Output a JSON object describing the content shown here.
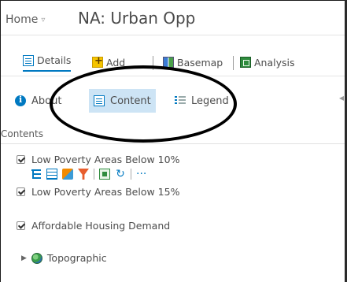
{
  "header": {
    "home_label": "Home",
    "home_chevron": "▿",
    "map_title": "NA: Urban Opp"
  },
  "toolbar": {
    "details_label": "Details",
    "add_label": "Add",
    "basemap_label": "Basemap",
    "analysis_label": "Analysis"
  },
  "tabs": {
    "about_label": "About",
    "content_label": "Content",
    "legend_label": "Legend"
  },
  "panel": {
    "section_label": "Contents",
    "collapse_glyph": "◂"
  },
  "layers": [
    {
      "name": "Low Poverty Areas Below 10%",
      "checked": true
    },
    {
      "name": "Low Poverty Areas Below 15%",
      "checked": true
    },
    {
      "name": "Affordable Housing Demand",
      "checked": true
    },
    {
      "name": "Topographic",
      "checked": false,
      "icon": "globe-icon"
    }
  ],
  "layer_tools": {
    "refresh_glyph": "↻",
    "more_glyph": "···"
  },
  "colors": {
    "accent": "#0079c1",
    "tab_selected_bg": "#cde4f5",
    "text": "#4c4c4c"
  }
}
